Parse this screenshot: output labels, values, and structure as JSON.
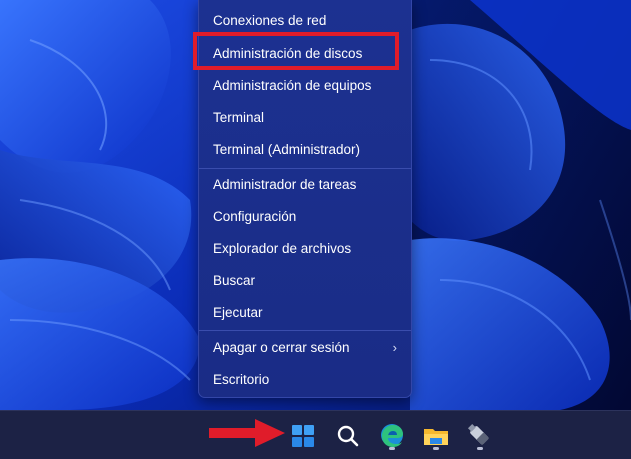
{
  "context_menu": {
    "items": [
      {
        "label": "Conexiones de red"
      },
      {
        "label": "Administración de discos"
      },
      {
        "label": "Administración de equipos"
      },
      {
        "label": "Terminal"
      },
      {
        "label": "Terminal (Administrador)"
      },
      {
        "label": "Administrador de tareas"
      },
      {
        "label": "Configuración"
      },
      {
        "label": "Explorador de archivos"
      },
      {
        "label": "Buscar"
      },
      {
        "label": "Ejecutar"
      },
      {
        "label": "Apagar o cerrar sesión",
        "submenu_icon": "chevron-right-icon"
      },
      {
        "label": "Escritorio"
      }
    ],
    "highlighted_item": "Administración de discos",
    "highlight_color": "#e01c2a"
  },
  "taskbar": {
    "icons": [
      {
        "name": "windows-start-icon"
      },
      {
        "name": "search-icon"
      },
      {
        "name": "edge-browser-icon"
      },
      {
        "name": "file-explorer-icon"
      },
      {
        "name": "usb-drive-icon"
      }
    ],
    "pointer_arrow_color": "#e01c2a"
  },
  "colors": {
    "menu_background": "#1b2f8c",
    "menu_text": "#ffffff",
    "taskbar_background": "#1c2245"
  }
}
